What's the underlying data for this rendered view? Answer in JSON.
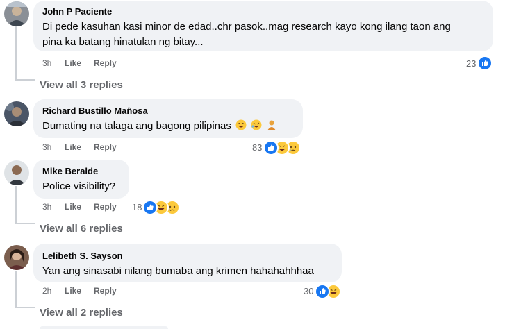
{
  "comments": [
    {
      "name": "John P Paciente",
      "text_lines": [
        "Di pede kasuhan kasi minor de edad..chr pasok..mag research kayo kong ilang taon ang",
        "pina ka batang hinatulan ng bitay..."
      ],
      "time": "3h",
      "like": "Like",
      "reply": "Reply",
      "reaction_count": "23",
      "reactions": [
        "like"
      ],
      "view_replies": "View all 3 replies"
    },
    {
      "name": "Richard Bustillo Mañosa",
      "text_lines": [
        "Dumating na talaga ang bagong pilipinas"
      ],
      "text_emojis": [
        "laugh-emoji",
        "rofl-emoji",
        "thinking-person-emoji"
      ],
      "time": "3h",
      "like": "Like",
      "reply": "Reply",
      "reaction_count": "83",
      "reactions": [
        "like",
        "haha",
        "sad"
      ]
    },
    {
      "name": "Mike Beralde",
      "text_lines": [
        "Police visibility?"
      ],
      "time": "3h",
      "like": "Like",
      "reply": "Reply",
      "reaction_count": "18",
      "reactions": [
        "like",
        "haha",
        "sad"
      ],
      "view_replies": "View all 6 replies"
    },
    {
      "name": "Lelibeth S. Sayson",
      "text_lines": [
        "Yan ang sinasabi nilang bumaba ang krimen hahahahhhaa"
      ],
      "time": "2h",
      "like": "Like",
      "reply": "Reply",
      "reaction_count": "30",
      "reactions": [
        "like",
        "haha"
      ],
      "view_replies": "View all 2 replies"
    }
  ],
  "colors": {
    "bubble": "#f0f2f5",
    "secondary_text": "#65676b",
    "like_blue": "#1877f2",
    "emoji_yellow": "#fcc93c"
  }
}
